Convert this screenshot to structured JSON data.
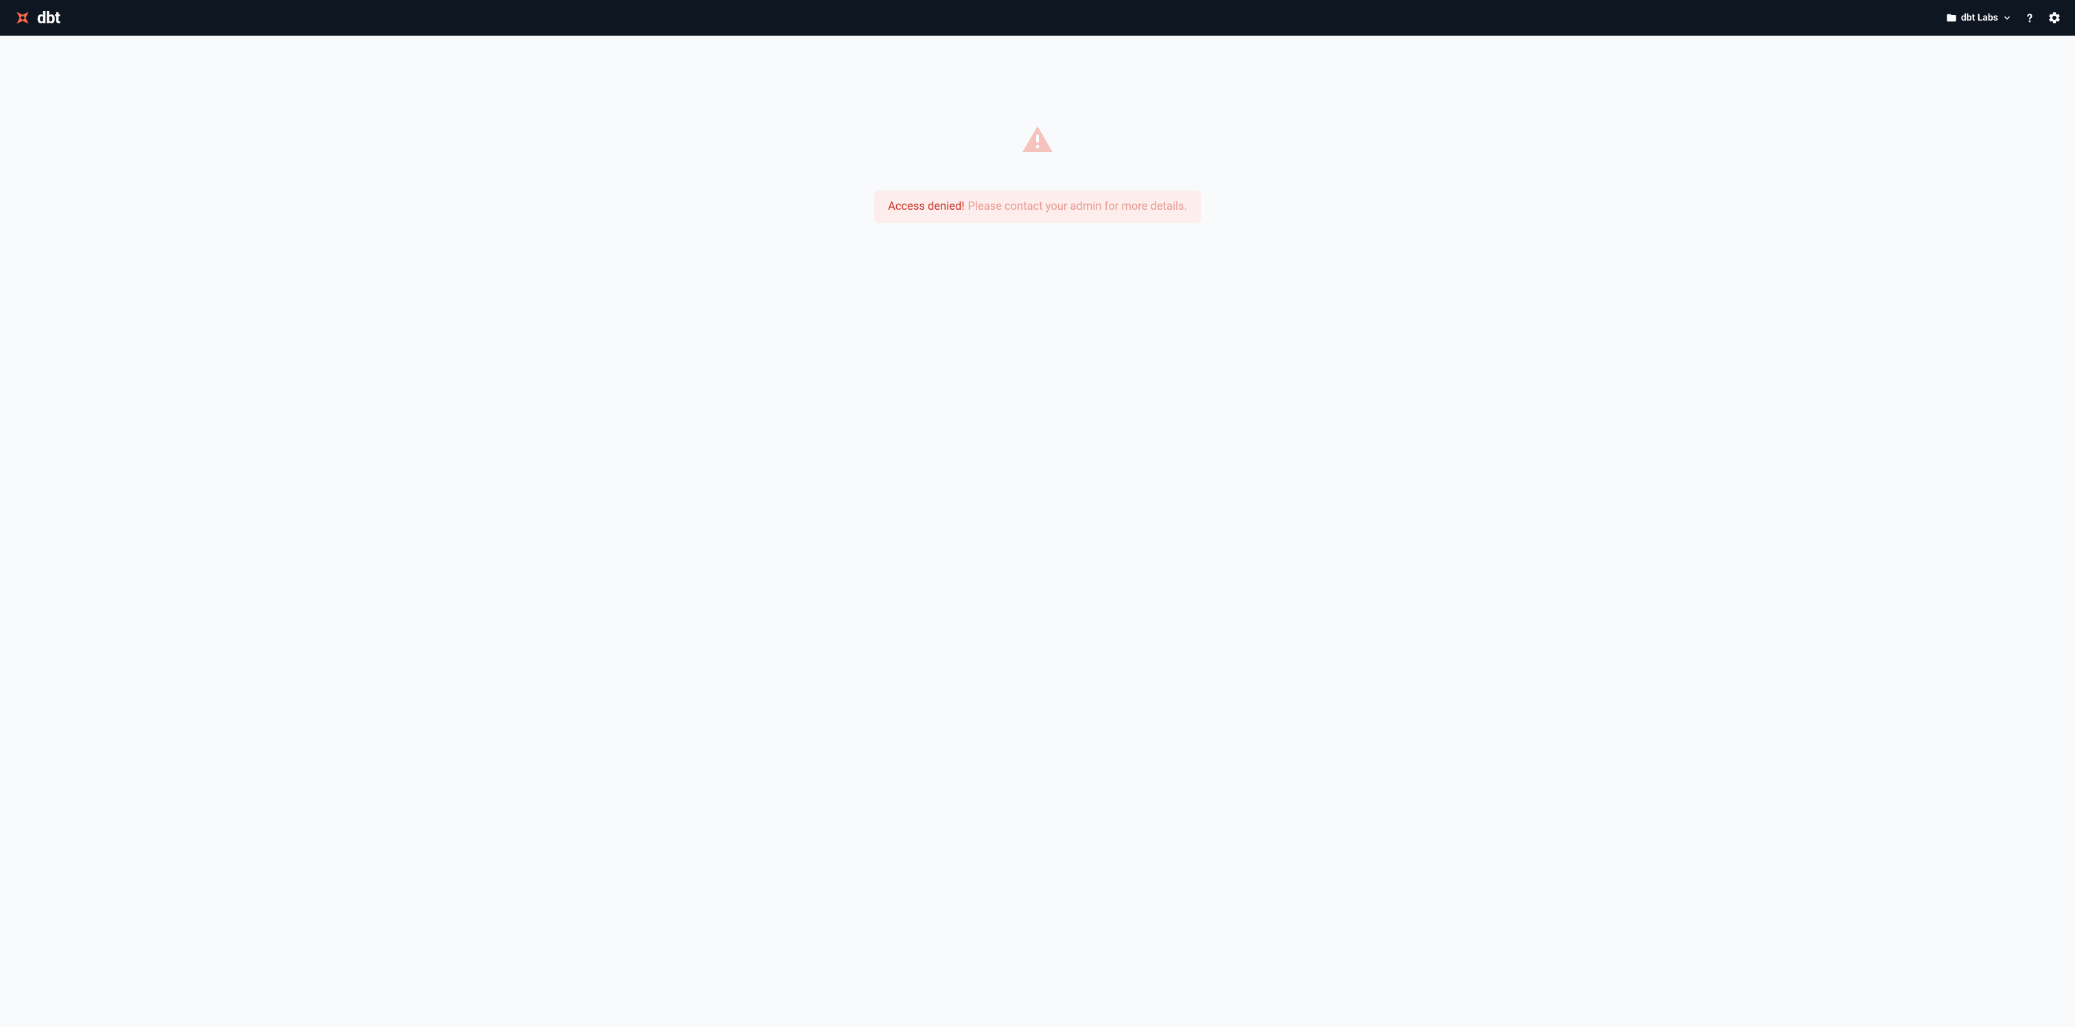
{
  "header": {
    "brand_name": "dbt",
    "project_name": "dbt Labs"
  },
  "main": {
    "error_title": "Access denied!",
    "error_detail": "Please contact your admin for more details."
  },
  "colors": {
    "navbar_bg": "#0e1622",
    "page_bg": "#f8fafc",
    "brand_orange": "#ff694a",
    "error_bg": "#fdedec",
    "error_primary": "#c9372c",
    "error_secondary": "#e99a93",
    "warning_icon": "#f5c2bd"
  }
}
